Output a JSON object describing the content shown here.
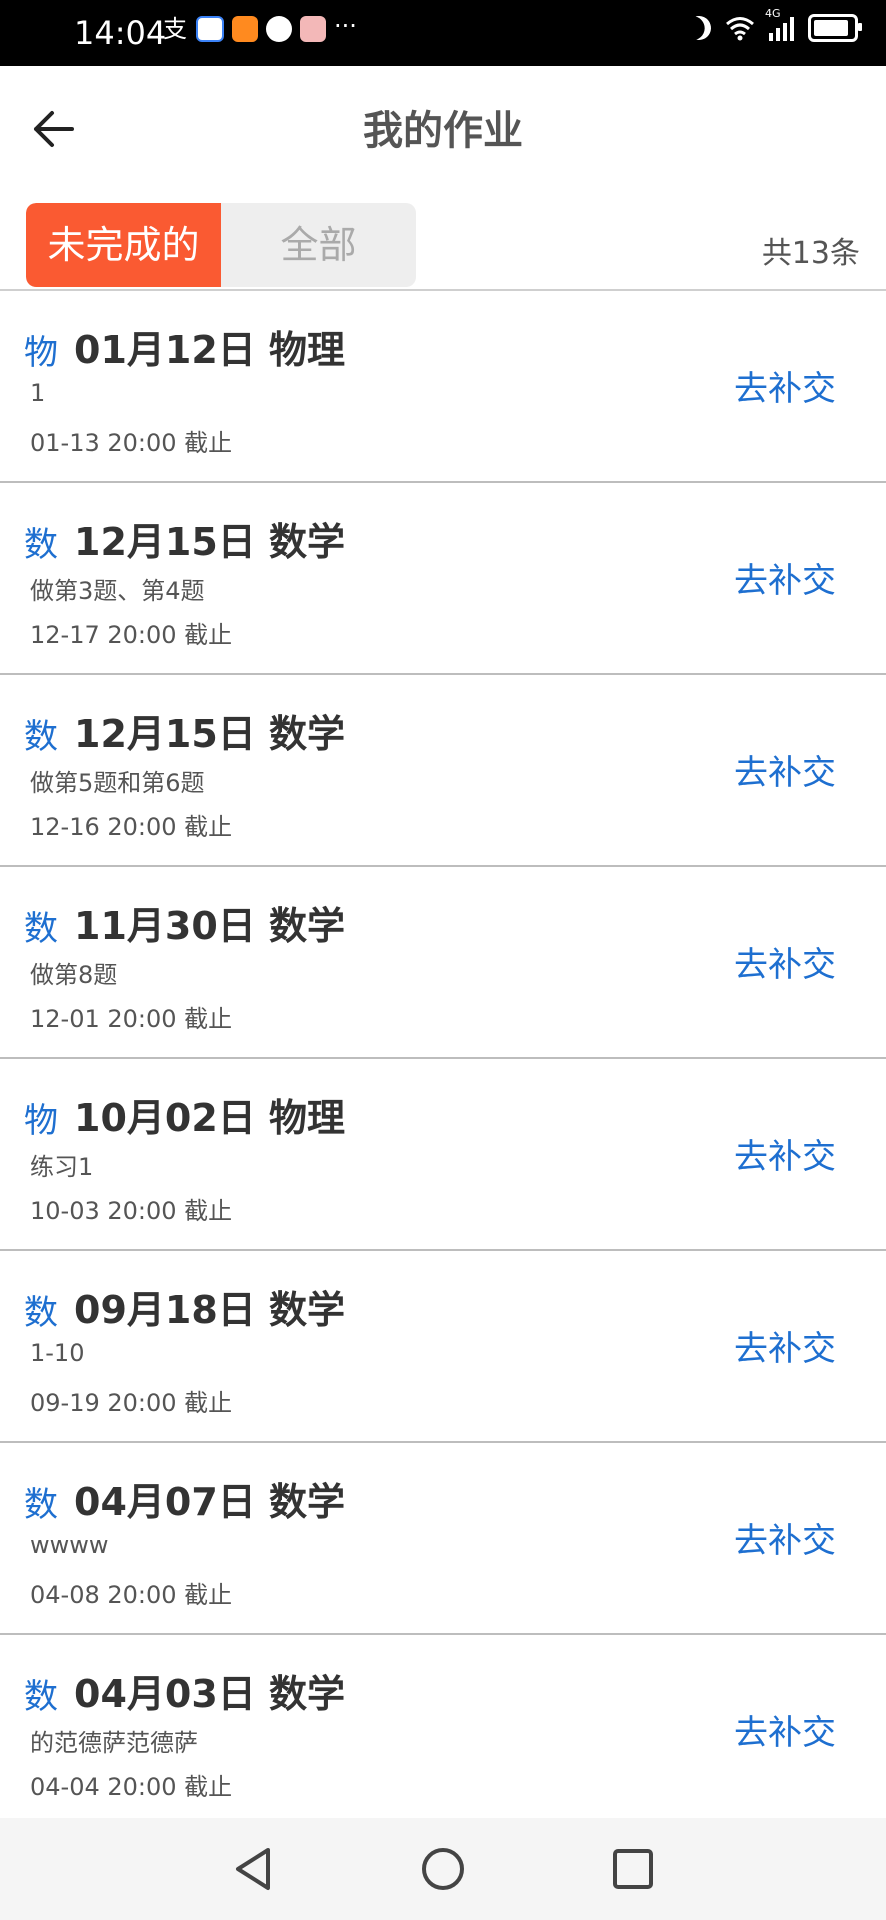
{
  "status_bar": {
    "time": "14:04",
    "left_icons": [
      "alipay-icon",
      "chat-icon",
      "video-icon",
      "ball-icon",
      "box-icon",
      "more-dots-icon"
    ],
    "more_text": "···",
    "network_label": "4G"
  },
  "header": {
    "title": "我的作业"
  },
  "tabs": [
    {
      "label": "未完成的",
      "active": true
    },
    {
      "label": "全部",
      "active": false
    }
  ],
  "summary": {
    "count_text": "共13条"
  },
  "colors": {
    "accent": "#fa5a32",
    "link": "#1e6fd0",
    "divider": "#bdbdbd"
  },
  "items": [
    {
      "subject_badge": "物",
      "title": "01月12日 物理",
      "description": "1",
      "deadline": "01-13 20:00 截止",
      "action": "去补交"
    },
    {
      "subject_badge": "数",
      "title": "12月15日 数学",
      "description": "做第3题、第4题",
      "deadline": "12-17 20:00 截止",
      "action": "去补交"
    },
    {
      "subject_badge": "数",
      "title": "12月15日 数学",
      "description": "做第5题和第6题",
      "deadline": "12-16 20:00 截止",
      "action": "去补交"
    },
    {
      "subject_badge": "数",
      "title": "11月30日 数学",
      "description": "做第8题",
      "deadline": "12-01 20:00 截止",
      "action": "去补交"
    },
    {
      "subject_badge": "物",
      "title": "10月02日 物理",
      "description": "练习1",
      "deadline": "10-03 20:00 截止",
      "action": "去补交"
    },
    {
      "subject_badge": "数",
      "title": "09月18日 数学",
      "description": "1-10",
      "deadline": "09-19 20:00 截止",
      "action": "去补交"
    },
    {
      "subject_badge": "数",
      "title": "04月07日 数学",
      "description": "wwww",
      "deadline": "04-08 20:00 截止",
      "action": "去补交"
    },
    {
      "subject_badge": "数",
      "title": "04月03日 数学",
      "description": "的范德萨范德萨",
      "deadline": "04-04 20:00 截止",
      "action": "去补交"
    }
  ],
  "nav": [
    "back-triangle-icon",
    "home-circle-icon",
    "recents-square-icon"
  ]
}
